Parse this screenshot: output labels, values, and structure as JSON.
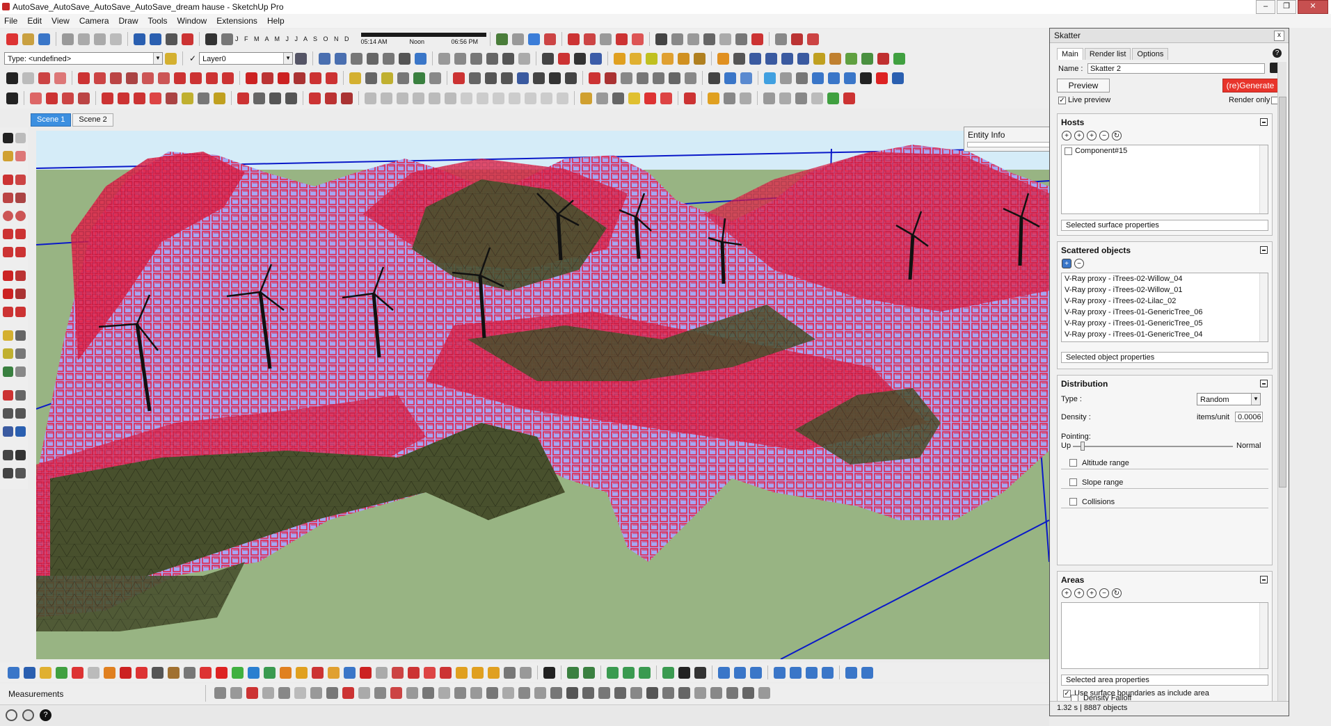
{
  "window": {
    "title": "AutoSave_AutoSave_AutoSave_AutoSave_dream hause - SketchUp Pro",
    "controls": [
      "–",
      "❐",
      "✕"
    ]
  },
  "menu": [
    "File",
    "Edit",
    "View",
    "Camera",
    "Draw",
    "Tools",
    "Window",
    "Extensions",
    "Help"
  ],
  "toolbar": {
    "months": "J F M A M J J A S O N D",
    "time_start": "05:14 AM",
    "time_mid": "Noon",
    "time_end": "06:56 PM",
    "type_dropdown": "Type: <undefined>",
    "layer_dropdown": "Layer0",
    "layer_check": "✓"
  },
  "scenes": [
    "Scene 1",
    "Scene 2"
  ],
  "entity_info": {
    "title": "Entity Info"
  },
  "statusbar": {
    "measurements_label": "Measurements",
    "help_icon": "?"
  },
  "skatter": {
    "title": "Skatter",
    "close": "x",
    "tabs": [
      "Main",
      "Render list",
      "Options"
    ],
    "help": "?",
    "name_label": "Name :",
    "name_value": "Skatter 2",
    "preview_button": "Preview",
    "generate_button": "(re)Generate",
    "live_preview": "Live preview",
    "render_only": "Render only",
    "hosts": {
      "title": "Hosts",
      "items": [
        "Component#15"
      ],
      "properties": "Selected surface properties"
    },
    "scattered": {
      "title": "Scattered objects",
      "items": [
        "V-Ray proxy - iTrees-02-Willow_04",
        "V-Ray proxy - iTrees-02-Willow_01",
        "V-Ray proxy - iTrees-02-Lilac_02",
        "V-Ray proxy - iTrees-01-GenericTree_06",
        "V-Ray proxy - iTrees-01-GenericTree_05",
        "V-Ray proxy - iTrees-01-GenericTree_04"
      ],
      "properties": "Selected object properties"
    },
    "distribution": {
      "title": "Distribution",
      "type_label": "Type :",
      "type_value": "Random",
      "density_label": "Density :",
      "density_unit": "items/unit",
      "density_value": "0.0006",
      "pointing_label": "Pointing:",
      "pointing_up": "Up",
      "pointing_normal": "Normal",
      "pointing_value": 0.05,
      "altitude": "Altitude range",
      "slope": "Slope range",
      "collisions": "Collisions"
    },
    "areas": {
      "title": "Areas",
      "properties": "Selected area properties",
      "use_boundaries": "Use surface boundaries as include area",
      "use_boundaries_checked": "✓",
      "density_falloff": "Density Falloff"
    },
    "footer": "1.32 s | 8887 objects"
  },
  "colors": {
    "terrain_purple": "#a6a6f2",
    "scatter_red": "#e3254a",
    "terrain_dark": "#48502d",
    "sky": "#d5ecf8",
    "ground": "#98b483",
    "boundary": "#0a19c8",
    "generate_red": "#e8342b",
    "scene_tab_active": "#3c8fe0"
  }
}
